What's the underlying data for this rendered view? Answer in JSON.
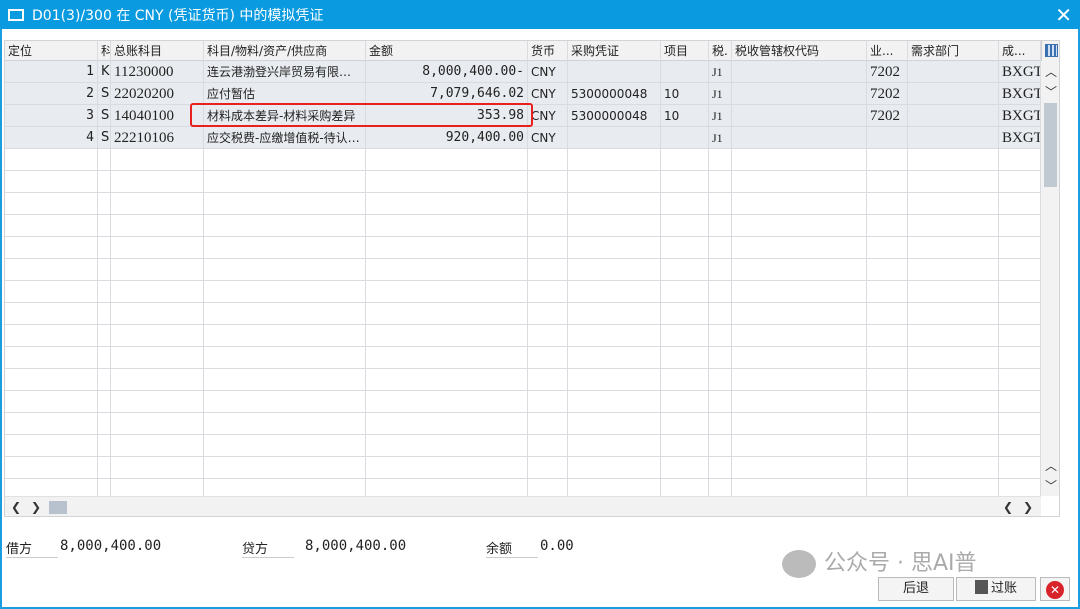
{
  "window": {
    "title": "D01(3)/300 在 CNY (凭证货币) 中的模拟凭证",
    "close": "✕"
  },
  "columns": [
    "定位",
    "科",
    "总账科目",
    "科目/物料/资产/供应商",
    "金额",
    "货币",
    "采购凭证",
    "项目",
    "税.",
    "税收管辖权代码",
    "业...",
    "需求部门",
    "成..."
  ],
  "rows": [
    {
      "pos": "1",
      "pk": "K",
      "gl": "11230000",
      "acct": "连云港渤登兴岸贸易有限…",
      "amount": "8,000,400.00-",
      "cur": "CNY",
      "po": "",
      "item": "",
      "tax": "J1",
      "jur": "",
      "bus": "7202",
      "dept": "",
      "cost": "BXGT"
    },
    {
      "pos": "2",
      "pk": "S",
      "gl": "22020200",
      "acct": "应付暂估",
      "amount": "7,079,646.02",
      "cur": "CNY",
      "po": "5300000048",
      "item": "10",
      "tax": "J1",
      "jur": "",
      "bus": "7202",
      "dept": "",
      "cost": "BXGT"
    },
    {
      "pos": "3",
      "pk": "S",
      "gl": "14040100",
      "acct": "材料成本差异-材料采购差异",
      "amount": "353.98",
      "cur": "CNY",
      "po": "5300000048",
      "item": "10",
      "tax": "J1",
      "jur": "",
      "bus": "7202",
      "dept": "",
      "cost": "BXGT"
    },
    {
      "pos": "4",
      "pk": "S",
      "gl": "22210106",
      "acct": "应交税费-应缴增值税-待认…",
      "amount": "920,400.00",
      "cur": "CNY",
      "po": "",
      "item": "",
      "tax": "J1",
      "jur": "",
      "bus": "",
      "dept": "",
      "cost": "BXGT"
    }
  ],
  "totals": {
    "debit_label": "借方",
    "debit": "8,000,400.00",
    "credit_label": "贷方",
    "credit": "8,000,400.00",
    "balance_label": "余额",
    "balance": "0.00"
  },
  "buttons": {
    "back": "后退",
    "post": "过账"
  },
  "watermark": "公众号 · 思AI普",
  "colors": {
    "title": "#0a9ae0",
    "highlight": "#e8201e"
  }
}
